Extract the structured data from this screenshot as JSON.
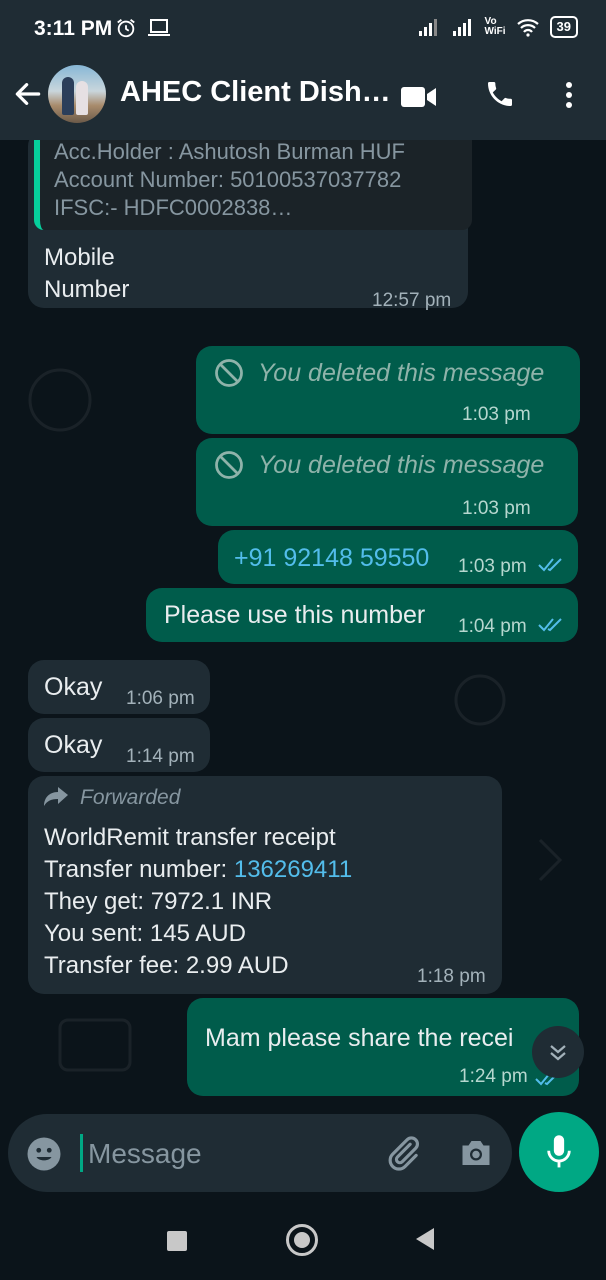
{
  "status_bar": {
    "time": "3:11 PM",
    "vo_wifi": "Vo\nWiFi",
    "battery": "39"
  },
  "header": {
    "contact_name": "AHEC Client Dish…"
  },
  "messages": [
    {
      "quote_lines": [
        "Acc.Holder : Ashutosh Burman HUF",
        "Account Number: 50100537037782",
        "IFSC:- HDFC0002838…"
      ],
      "text_line1": "Mobile",
      "text_line2": "Number",
      "time": "12:57 pm"
    },
    {
      "text": "You deleted this message",
      "time": "1:03 pm"
    },
    {
      "text": "You deleted this message",
      "time": "1:03 pm"
    },
    {
      "text": "+91 92148 59550",
      "time": "1:03 pm"
    },
    {
      "text": "Please use this number",
      "time": "1:04 pm"
    },
    {
      "text": "Okay",
      "time": "1:06 pm"
    },
    {
      "text": "Okay",
      "time": "1:14 pm"
    },
    {
      "forwarded_label": "Forwarded",
      "line1": "WorldRemit transfer receipt",
      "line2_label": "Transfer number: ",
      "line2_link": "136269411",
      "line3": "They get: 7972.1 INR",
      "line4": "You sent: 145 AUD",
      "line5": "Transfer fee:  2.99 AUD",
      "time": "1:18 pm"
    },
    {
      "text": "Mam please share the recei",
      "time": "1:24 pm"
    }
  ],
  "composer": {
    "placeholder": "Message"
  },
  "colors": {
    "incoming_bubble": "#1f2c34",
    "outgoing_bubble": "#005c4b",
    "accent": "#00a884",
    "link": "#53bdeb",
    "background": "#0b141a"
  }
}
